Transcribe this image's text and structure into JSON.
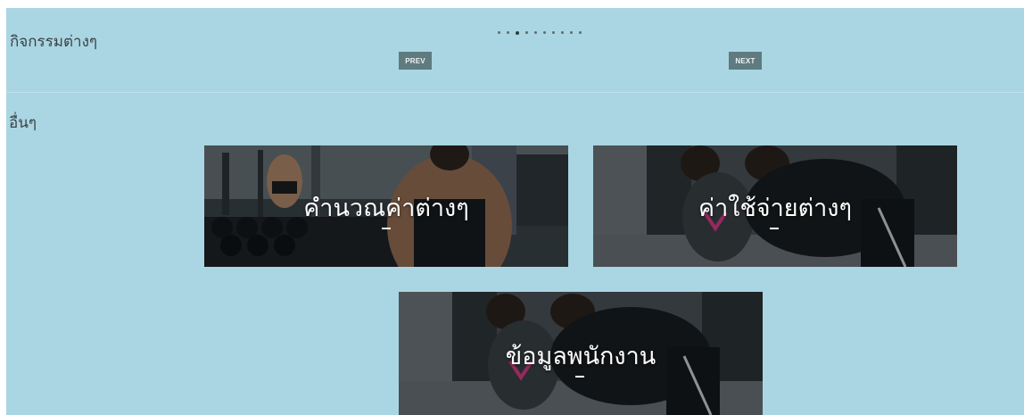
{
  "sections": {
    "activities_title": "กิจกรรมต่างๆ",
    "others_title": "อื่นๆ"
  },
  "carousel": {
    "dot_count": 10,
    "active_index": 2,
    "prev_label": "PREV",
    "next_label": "NEXT"
  },
  "cards": [
    {
      "label": "คำนวณค่าต่างๆ"
    },
    {
      "label": "ค่าใช้จ่ายต่างๆ"
    },
    {
      "label": "ข้อมูลพนักงาน"
    }
  ],
  "colors": {
    "background": "#a9d6e2",
    "button": "#5f7b80",
    "text": "#3c4246"
  }
}
